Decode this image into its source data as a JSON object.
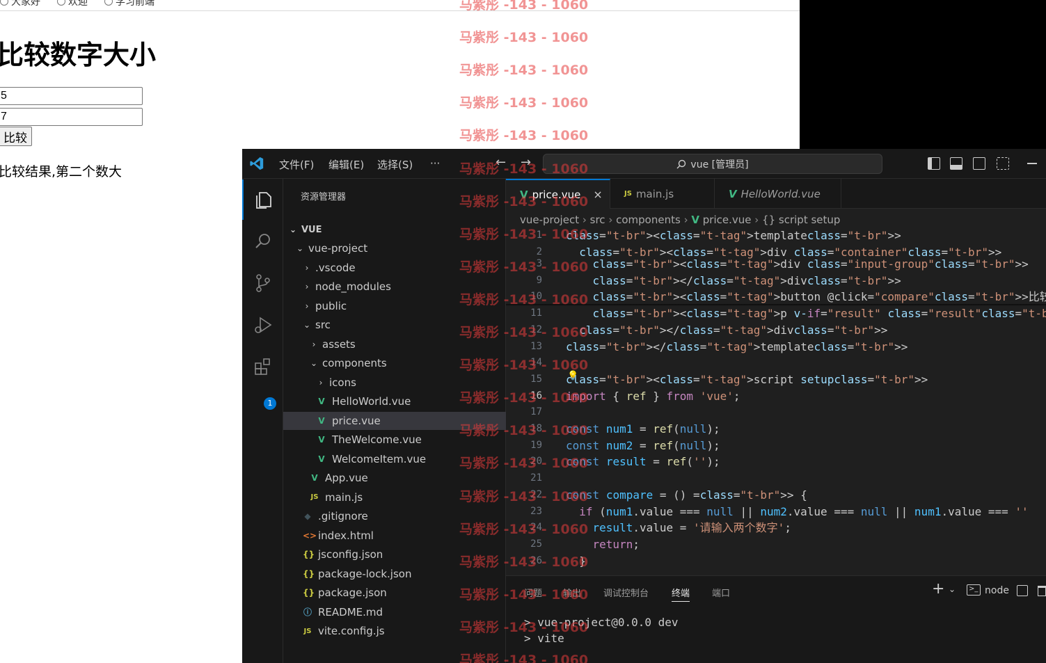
{
  "browser": {
    "radios": [
      "大家好",
      "欢迎",
      "学习前端"
    ],
    "heading": "比较数字大小",
    "input1": "5",
    "input2": "7",
    "button": "比较",
    "result": "比较结果,第二个数大"
  },
  "vscode": {
    "menus": [
      "文件(F)",
      "编辑(E)",
      "选择(S)",
      "···"
    ],
    "search": "vue [管理员]",
    "activity_badge": "1",
    "sidebar": {
      "title": "资源管理器",
      "root": "VUE",
      "items": [
        {
          "label": "vue-project",
          "icon": "chevron-down"
        },
        {
          "label": ".vscode",
          "icon": "chevron-right"
        },
        {
          "label": "node_modules",
          "icon": "chevron-right"
        },
        {
          "label": "public",
          "icon": "chevron-right"
        },
        {
          "label": "src",
          "icon": "chevron-down"
        },
        {
          "label": "assets",
          "icon": "chevron-right"
        },
        {
          "label": "components",
          "icon": "chevron-down"
        },
        {
          "label": "icons",
          "icon": "chevron-right"
        },
        {
          "label": "HelloWorld.vue",
          "icon": "vue"
        },
        {
          "label": "price.vue",
          "icon": "vue"
        },
        {
          "label": "TheWelcome.vue",
          "icon": "vue"
        },
        {
          "label": "WelcomeItem.vue",
          "icon": "vue"
        },
        {
          "label": "App.vue",
          "icon": "vue"
        },
        {
          "label": "main.js",
          "icon": "js"
        },
        {
          "label": ".gitignore",
          "icon": "git"
        },
        {
          "label": "index.html",
          "icon": "html"
        },
        {
          "label": "jsconfig.json",
          "icon": "json"
        },
        {
          "label": "package-lock.json",
          "icon": "json"
        },
        {
          "label": "package.json",
          "icon": "json"
        },
        {
          "label": "README.md",
          "icon": "info"
        },
        {
          "label": "vite.config.js",
          "icon": "js"
        }
      ]
    },
    "tabs": [
      {
        "label": "price.vue",
        "close": "×"
      },
      {
        "label": "main.js"
      },
      {
        "label": "HelloWorld.vue"
      }
    ],
    "breadcrumb": {
      "parts": [
        "vue-project",
        "src",
        "components",
        "price.vue",
        "{} script setup"
      ]
    },
    "code": {
      "lines": [
        {
          "n": "1",
          "text": "<template>"
        },
        {
          "n": "2",
          "text": "  <div class=\"container\">"
        },
        {
          "n": "3",
          "text": "    <div class=\"input-group\">"
        },
        {
          "n": "9",
          "text": "    </div>"
        },
        {
          "n": "10",
          "text": "    <button @click=\"compare\">比较</button>"
        },
        {
          "n": "11",
          "text": "    <p v-if=\"result\" class=\"result\">{{ result }}</p>"
        },
        {
          "n": "12",
          "text": "  </div>"
        },
        {
          "n": "13",
          "text": "</template>"
        },
        {
          "n": "14",
          "text": ""
        },
        {
          "n": "15",
          "text": "<script setup>"
        },
        {
          "n": "16",
          "text": "import { ref } from 'vue';"
        },
        {
          "n": "17",
          "text": ""
        },
        {
          "n": "18",
          "text": "const num1 = ref(null);"
        },
        {
          "n": "19",
          "text": "const num2 = ref(null);"
        },
        {
          "n": "20",
          "text": "const result = ref('');"
        },
        {
          "n": "21",
          "text": ""
        },
        {
          "n": "22",
          "text": "const compare = () => {"
        },
        {
          "n": "23",
          "text": "  if (num1.value === null || num2.value === null || num1.value === ''"
        },
        {
          "n": "24",
          "text": "    result.value = '请输入两个数字';"
        },
        {
          "n": "25",
          "text": "    return;"
        },
        {
          "n": "26",
          "text": "  }"
        }
      ]
    },
    "panel": {
      "tabs": [
        "问题",
        "输出",
        "调试控制台",
        "终端",
        "端口"
      ],
      "active_tab": "终端",
      "terminal_name": "node",
      "terminal_lines": [
        "> vue-project@0.0.0 dev",
        "> vite"
      ]
    }
  },
  "watermark": "马紫彤 -143 - 1060",
  "colors": {
    "accent": "#0078d4",
    "vue_green": "#41b883",
    "watermark": "#e63c3c"
  }
}
